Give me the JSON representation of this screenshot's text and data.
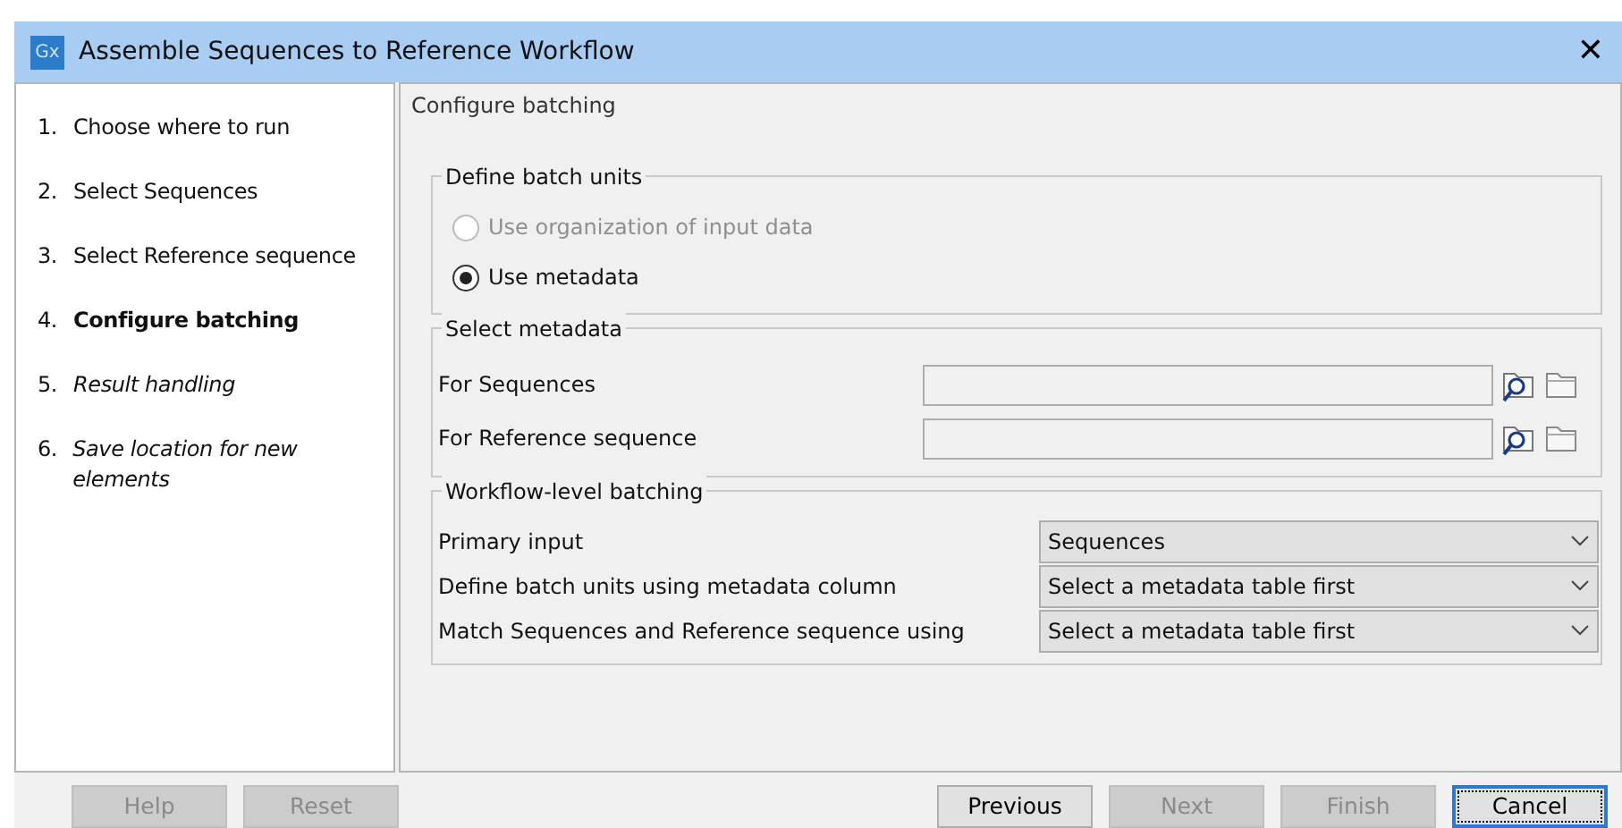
{
  "window": {
    "title": "Assemble Sequences to Reference Workflow",
    "app_icon": "Gx",
    "close": "✕"
  },
  "steps": [
    {
      "number": "1.",
      "label": "Choose where to run",
      "current": false,
      "visited": true
    },
    {
      "number": "2.",
      "label": "Select Sequences",
      "current": false,
      "visited": true
    },
    {
      "number": "3.",
      "label": "Select Reference sequence",
      "current": false,
      "visited": true
    },
    {
      "number": "4.",
      "label": "Configure batching",
      "current": true,
      "visited": true
    },
    {
      "number": "5.",
      "label": "Result handling",
      "current": false,
      "visited": false
    },
    {
      "number": "6.",
      "label": "Save location for new elements",
      "current": false,
      "visited": false
    }
  ],
  "panel_title": "Configure batching",
  "batch_units": {
    "title": "Define batch units",
    "options": [
      {
        "label": "Use organization of input data",
        "selected": false,
        "disabled": true
      },
      {
        "label": "Use metadata",
        "selected": true,
        "disabled": false
      }
    ]
  },
  "select_metadata": {
    "title": "Select metadata",
    "fields": [
      {
        "label": "For Sequences"
      },
      {
        "label": "For Reference sequence"
      }
    ]
  },
  "workflow_batching": {
    "title": "Workflow-level batching",
    "rows": [
      {
        "label": "Primary input",
        "value": "Sequences"
      },
      {
        "label": "Define batch units using metadata column",
        "value": "Select a metadata table first"
      },
      {
        "label": "Match Sequences and Reference sequence using",
        "value": "Select a metadata table first"
      }
    ]
  },
  "left_buttons": [
    {
      "label": "Help",
      "disabled": true,
      "focused": false
    },
    {
      "label": "Reset",
      "disabled": true,
      "focused": false
    }
  ],
  "right_buttons": [
    {
      "label": "Previous",
      "disabled": false,
      "focused": false
    },
    {
      "label": "Next",
      "disabled": true,
      "focused": false
    },
    {
      "label": "Finish",
      "disabled": true,
      "focused": false
    },
    {
      "label": "Cancel",
      "disabled": false,
      "focused": true
    }
  ]
}
